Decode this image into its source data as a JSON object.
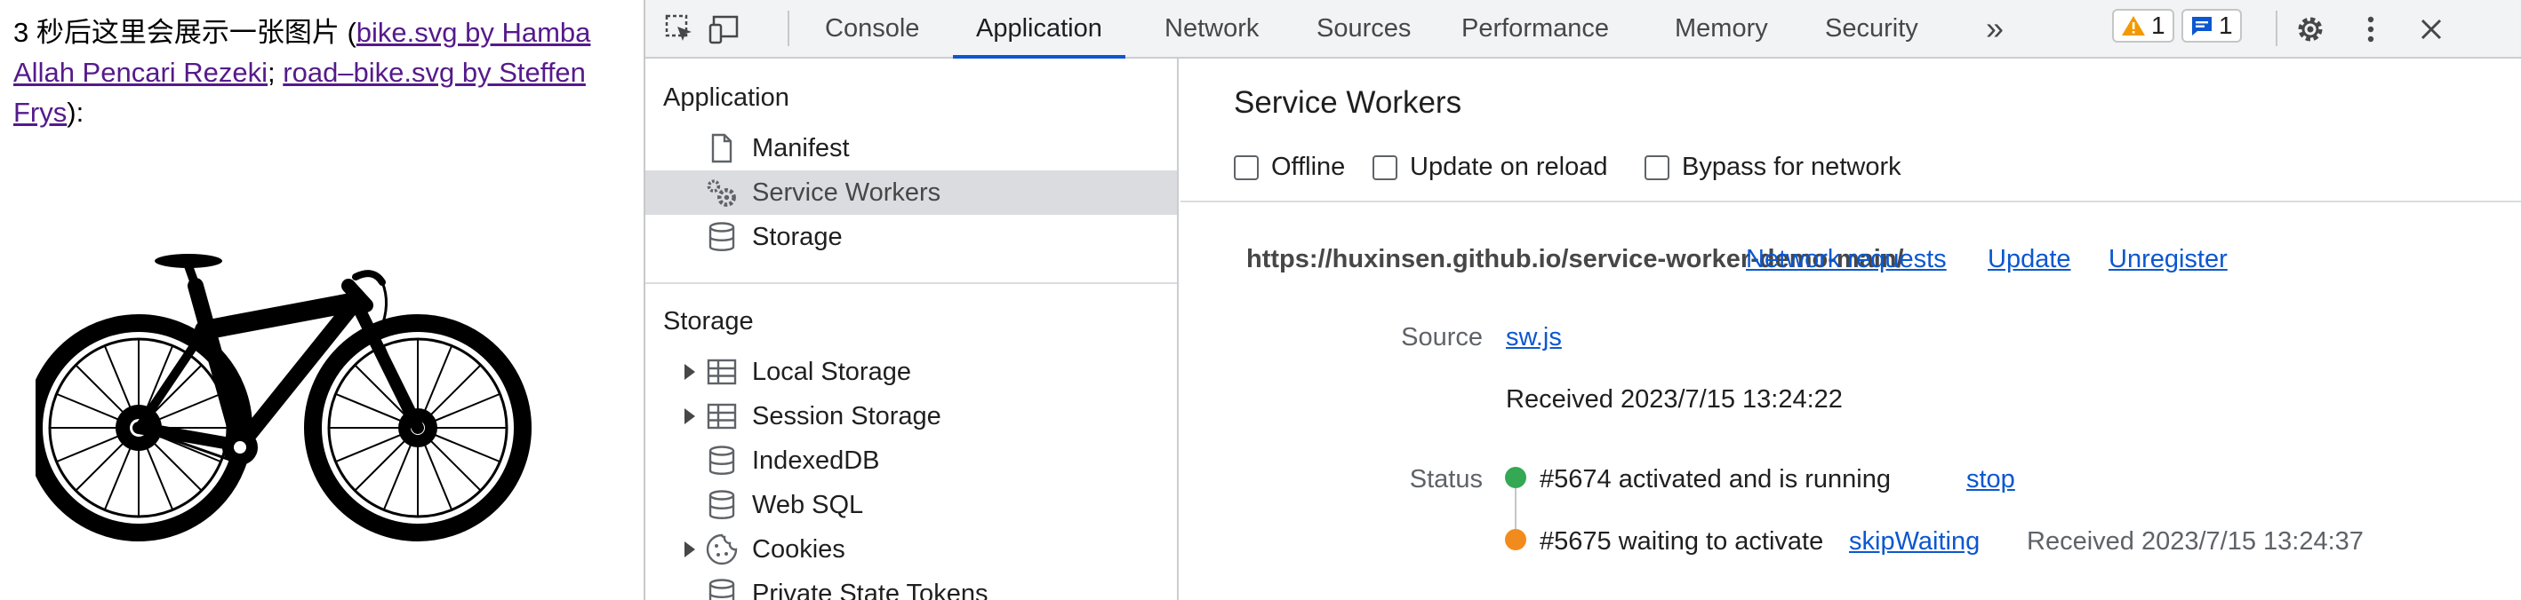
{
  "page": {
    "intro": "3 秒后这里会展示一张图片 (",
    "link1": "bike.svg by Hamba Allah Pencari Rezeki",
    "sep": "; ",
    "link2": "road–bike.svg by Steffen Frys",
    "outro": "):"
  },
  "toolbar": {
    "icons": [
      "inspect-element-icon",
      "device-toolbar-icon"
    ],
    "tabs": [
      "Console",
      "Application",
      "Network",
      "Sources",
      "Performance",
      "Memory",
      "Security"
    ],
    "active_tab": "Application",
    "more_tabs": "»",
    "warnings_count": "1",
    "messages_count": "1"
  },
  "sidebar": {
    "application_header": "Application",
    "application_items": [
      {
        "label": "Manifest",
        "icon": "file-icon"
      },
      {
        "label": "Service Workers",
        "icon": "gears-icon",
        "selected": true
      },
      {
        "label": "Storage",
        "icon": "database-icon"
      }
    ],
    "storage_header": "Storage",
    "storage_items": [
      {
        "label": "Local Storage",
        "icon": "table-icon",
        "expandable": true
      },
      {
        "label": "Session Storage",
        "icon": "table-icon",
        "expandable": true
      },
      {
        "label": "IndexedDB",
        "icon": "database-icon"
      },
      {
        "label": "Web SQL",
        "icon": "database-icon"
      },
      {
        "label": "Cookies",
        "icon": "cookie-icon",
        "expandable": true
      },
      {
        "label": "Private State Tokens",
        "icon": "database-icon"
      }
    ]
  },
  "main": {
    "title": "Service Workers",
    "checkboxes": [
      {
        "label": "Offline",
        "checked": false
      },
      {
        "label": "Update on reload",
        "checked": false
      },
      {
        "label": "Bypass for network",
        "checked": false
      }
    ],
    "scope_url": "https://huxinsen.github.io/service-worker-demo-main/",
    "actions": [
      "Network requests",
      "Update",
      "Unregister"
    ],
    "source_label": "Source",
    "source_file": "sw.js",
    "received": "Received 2023/7/15 13:24:22",
    "status_label": "Status",
    "status_active": "#5674 activated and is running",
    "status_active_action": "stop",
    "status_waiting": "#5675 waiting to activate",
    "status_waiting_action": "skipWaiting",
    "status_waiting_received": "Received 2023/7/15 13:24:37"
  },
  "colors": {
    "accent": "#0b57d0",
    "active_dot": "#34a853",
    "waiting_dot": "#f28b1e",
    "warning": "#f29900"
  }
}
